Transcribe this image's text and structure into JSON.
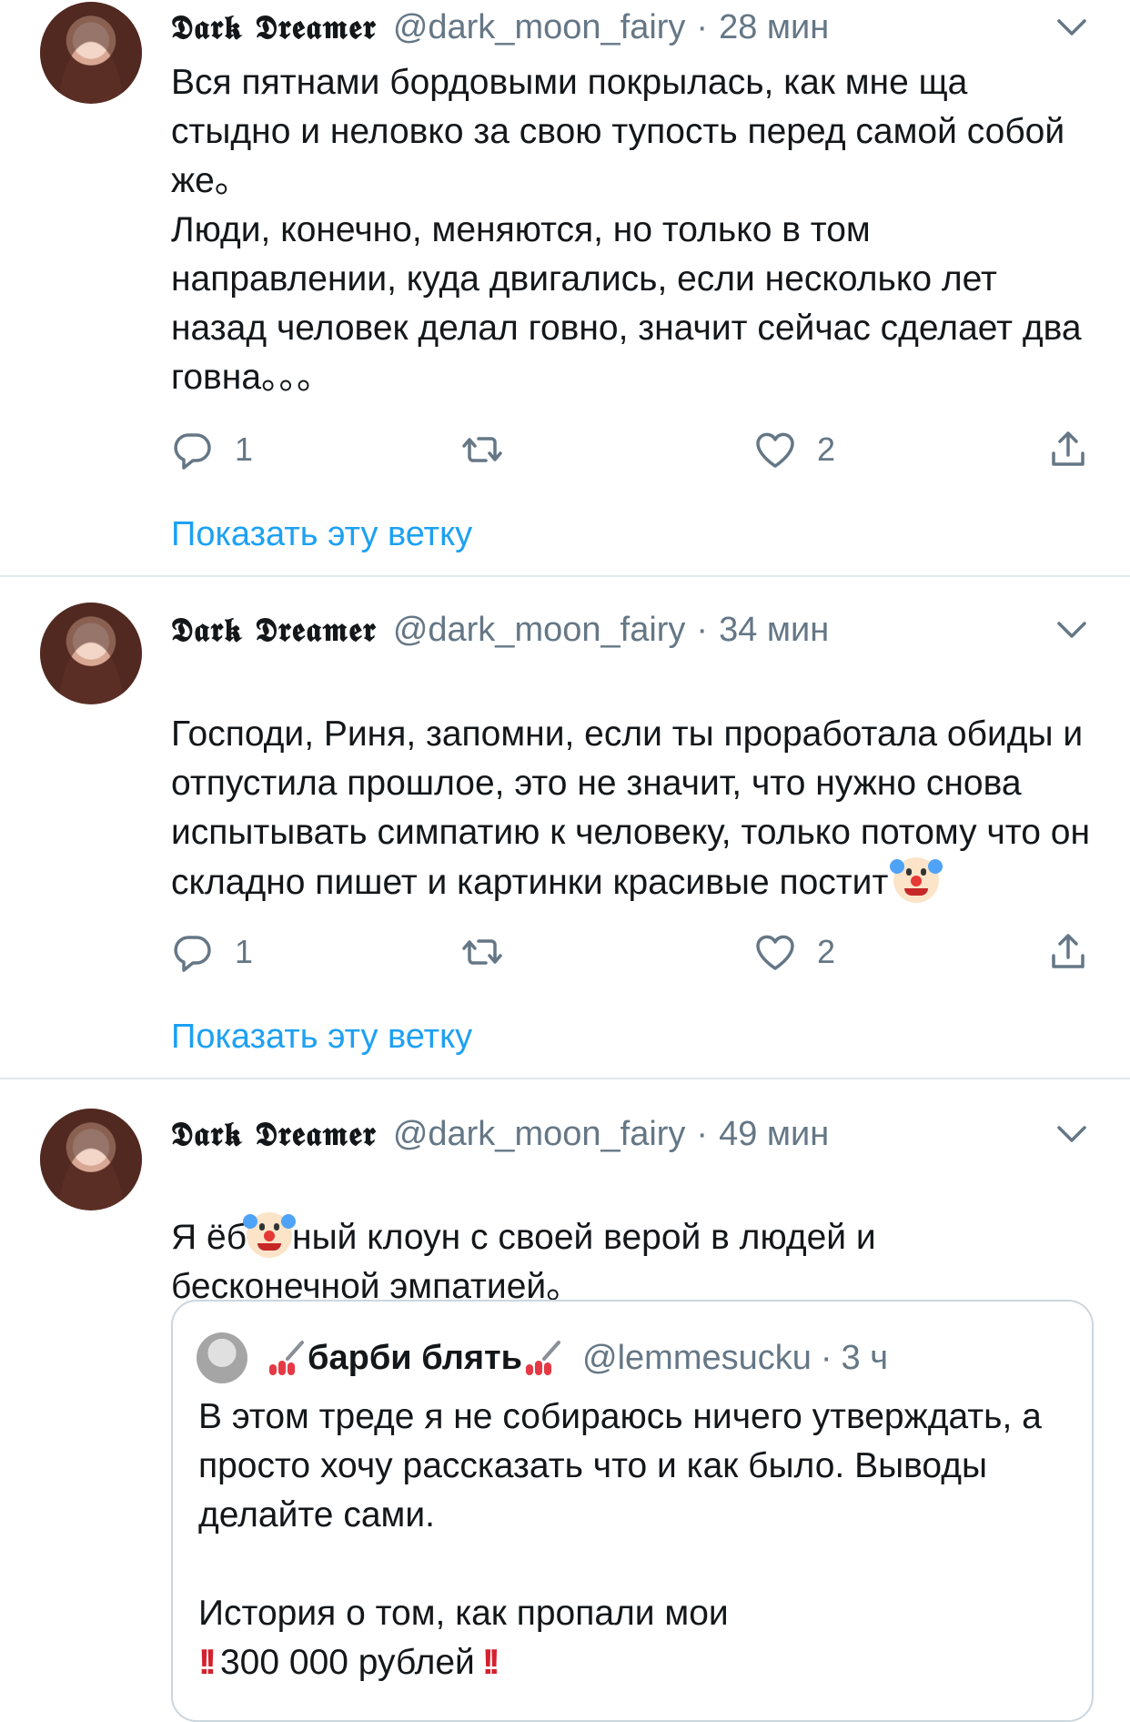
{
  "tweets": [
    {
      "display_name": "𝕯𝖆𝖗𝖐 𝕯𝖗𝖊𝖆𝖒𝖊𝖗",
      "handle": "@dark_moon_fairy",
      "time": "28 мин",
      "text": "Вся пятнами бордовыми покрылась, как мне ща стыдно и неловко за свою тупость перед самой собой же。\nЛюди, конечно, меняются, но только в том направлении, куда двигались, если несколько лет назад человек делал говно, значит сейчас сделает два говна。。。",
      "replies": "1",
      "likes": "2",
      "show_thread": "Показать эту ветку"
    },
    {
      "display_name": "𝕯𝖆𝖗𝖐 𝕯𝖗𝖊𝖆𝖒𝖊𝖗",
      "handle": "@dark_moon_fairy",
      "time": "34 мин",
      "text": "Господи, Риня, запомни, если ты проработала обиды и отпустила прошлое, это не значит, что нужно снова испытывать симпатию к человеку, только потому что он складно пишет и картинки красивые постит",
      "replies": "1",
      "likes": "2",
      "show_thread": "Показать эту ветку"
    },
    {
      "display_name": "𝕯𝖆𝖗𝖐 𝕯𝖗𝖊𝖆𝖒𝖊𝖗",
      "handle": "@dark_moon_fairy",
      "time": "49 мин",
      "text_before": "Я ёб",
      "text_after": "ный клоун с своей верой в людей и бесконечной эмпатией。"
    }
  ],
  "quote": {
    "name": "барби блять",
    "handle": "@lemmesucku",
    "time": "3 ч",
    "text": "В этом треде я не собираюсь ничего утверждать, а просто хочу рассказать что и как было. Выводы делайте сами.\n\nИстория о том, как пропали мои",
    "last_line": "300 000 рублей"
  },
  "separator": "·",
  "icons": [
    "reply-icon",
    "retweet-icon",
    "like-icon",
    "share-icon",
    "chevron-down-icon",
    "clown-emoji",
    "nail-polish-emoji",
    "double-exclamation-emoji"
  ],
  "colors": {
    "link": "#1da1f2",
    "muted": "#657786",
    "text": "#14171a",
    "divider": "#e1e8ed"
  }
}
